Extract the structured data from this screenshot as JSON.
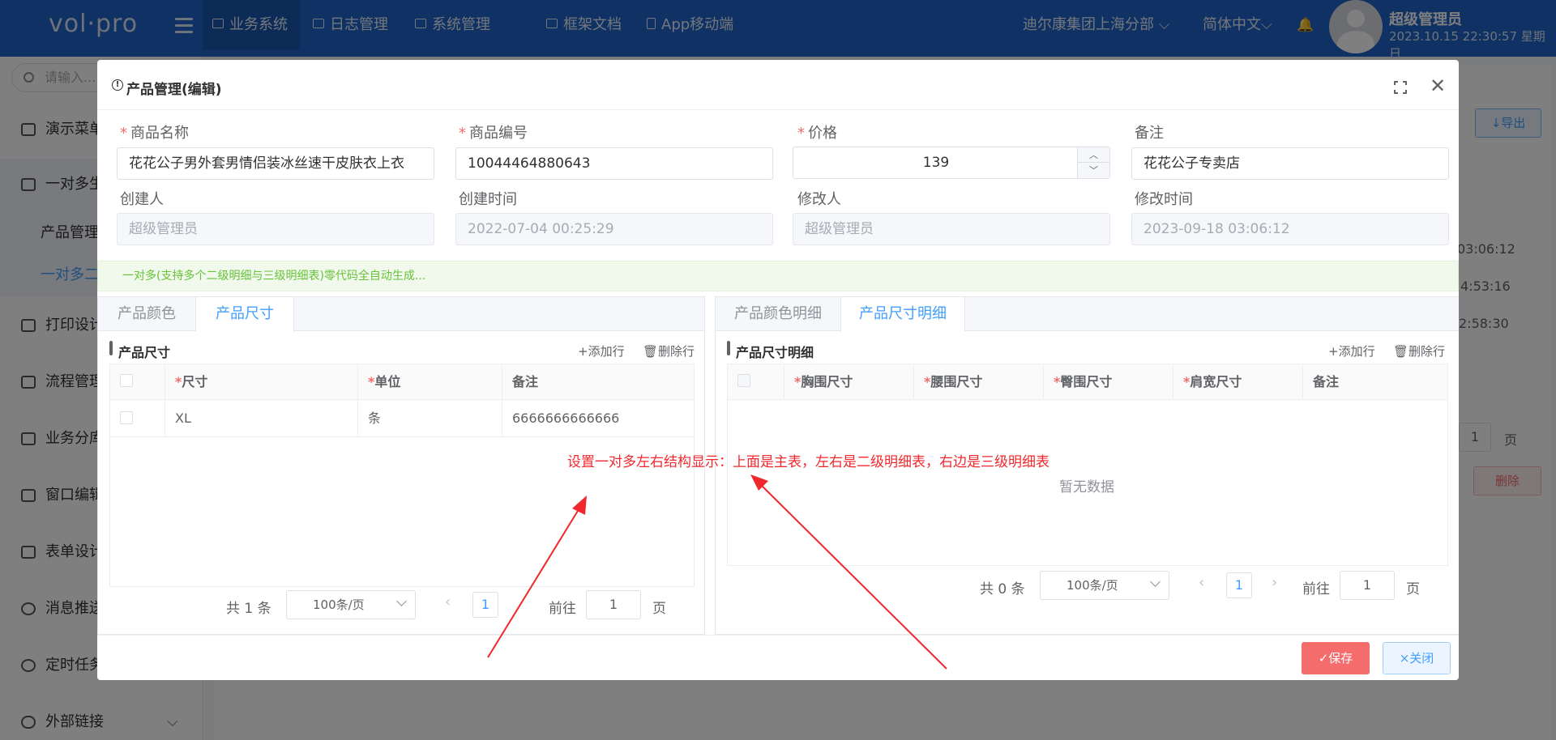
{
  "app": {
    "logo": "vol·pro",
    "nav": [
      "业务系统",
      "日志管理",
      "系统管理",
      "框架文档",
      "App移动端"
    ],
    "org": "迪尔康集团上海分部",
    "language": "简体中文",
    "user_name": "超级管理员",
    "user_datetime": "2023.10.15 22:30:57 星期日"
  },
  "sidebar": {
    "search_placeholder": "请输入...",
    "items": [
      "演示菜单",
      "一对多生",
      "产品管理",
      "一对多二",
      "打印设计",
      "流程管理",
      "业务分库",
      "窗口编辑",
      "表单设计",
      "消息推送",
      "定时任务",
      "外部链接"
    ]
  },
  "background": {
    "export_label": "↓导出",
    "delete_label": "删除",
    "times": [
      "03:06:12",
      "4:53:16",
      "2:58:30"
    ],
    "page_label": "页",
    "page_value": "1"
  },
  "modal": {
    "title": "产品管理(编辑)",
    "fields": {
      "name_label": "商品名称",
      "name_value": "花花公子男外套男情侣装冰丝速干皮肤衣上衣",
      "code_label": "商品编号",
      "code_value": "10044464880643",
      "price_label": "价格",
      "price_value": "139",
      "remark_label": "备注",
      "remark_value": "花花公子专卖店",
      "creator_label": "创建人",
      "creator_value": "超级管理员",
      "created_label": "创建时间",
      "created_value": "2022-07-04 00:25:29",
      "modifier_label": "修改人",
      "modifier_value": "超级管理员",
      "modified_label": "修改时间",
      "modified_value": "2023-09-18 03:06:12"
    },
    "alert": "一对多(支持多个二级明细与三级明细表)零代码全自动生成...",
    "left": {
      "tabs": [
        "产品颜色",
        "产品尺寸"
      ],
      "grid_title": "产品尺寸",
      "add_row": "+添加行",
      "del_row": "删除行",
      "columns": [
        "尺寸",
        "单位",
        "备注"
      ],
      "rows": [
        {
          "size": "XL",
          "unit": "条",
          "remark": "6666666666666"
        }
      ],
      "total": "共 1 条",
      "page_size": "100条/页",
      "page": "1",
      "goto": "前往",
      "goto_value": "1",
      "page_unit": "页"
    },
    "right": {
      "tabs": [
        "产品颜色明细",
        "产品尺寸明细"
      ],
      "grid_title": "产品尺寸明细",
      "add_row": "+添加行",
      "del_row": "删除行",
      "columns": [
        "胸围尺寸",
        "腰围尺寸",
        "臀围尺寸",
        "肩宽尺寸",
        "备注"
      ],
      "empty": "暂无数据",
      "total": "共 0 条",
      "page_size": "100条/页",
      "page": "1",
      "goto": "前往",
      "goto_value": "1",
      "page_unit": "页"
    },
    "save": "✓保存",
    "close": "×关闭"
  },
  "annotation": "设置一对多左右结构显示：上面是主表，左右是二级明细表，右边是三级明细表"
}
